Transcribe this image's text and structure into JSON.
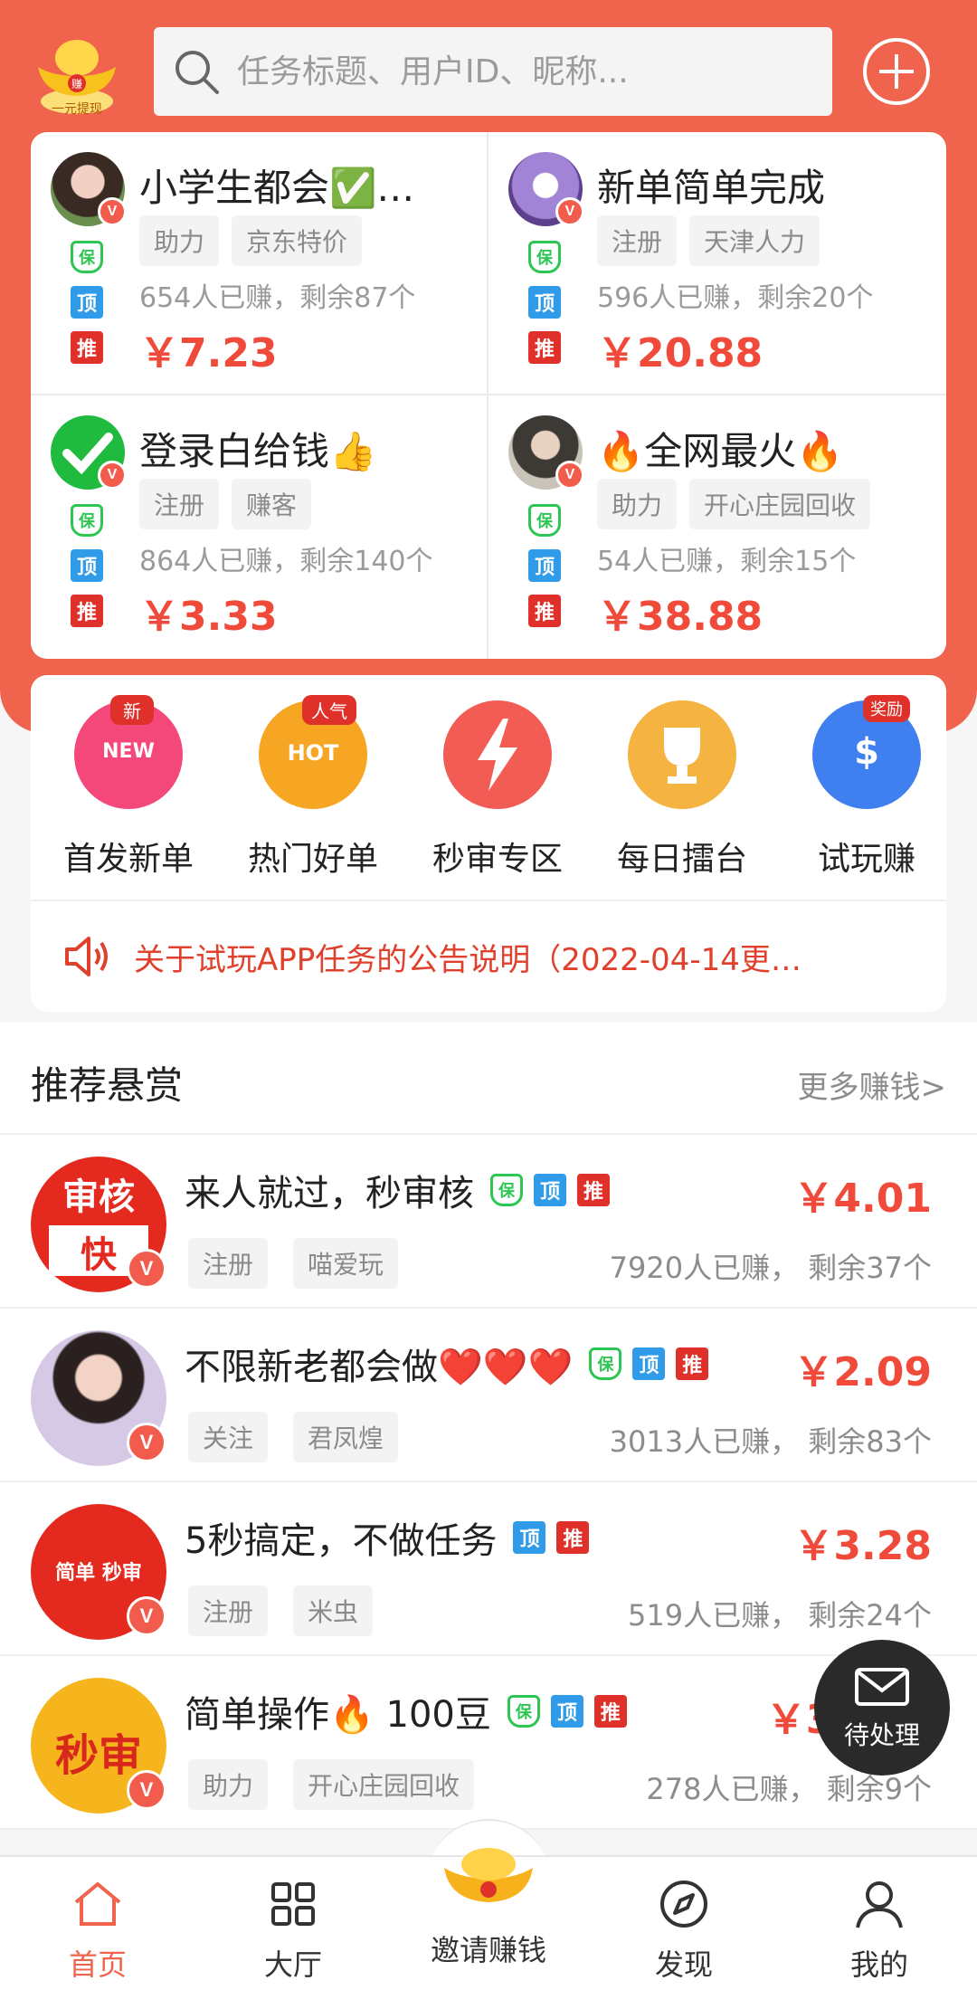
{
  "header": {
    "logo_text": "一元提现",
    "search_placeholder": "任务标题、用户ID、昵称..."
  },
  "featured": [
    {
      "title": "小学生都会✅…",
      "tags": [
        "助力",
        "京东特价"
      ],
      "stat": "654人已赚，剩余87个",
      "price": "￥7.23"
    },
    {
      "title": "新单简单完成",
      "tags": [
        "注册",
        "天津人力"
      ],
      "stat": "596人已赚，剩余20个",
      "price": "￥20.88"
    },
    {
      "title": "登录白给钱👍",
      "tags": [
        "注册",
        "赚客"
      ],
      "stat": "864人已赚，剩余140个",
      "price": "￥3.33"
    },
    {
      "title": "🔥全网最火🔥",
      "tags": [
        "助力",
        "开心庄园回收"
      ],
      "stat": "54人已赚，剩余15个",
      "price": "￥38.88"
    }
  ],
  "badges": {
    "bao": "保",
    "ding": "顶",
    "tui": "推",
    "v": "V"
  },
  "categories": [
    {
      "label": "首发新单",
      "badge": "新",
      "inner": "NEW"
    },
    {
      "label": "热门好单",
      "badge": "人气",
      "inner": "HOT"
    },
    {
      "label": "秒审专区"
    },
    {
      "label": "每日擂台"
    },
    {
      "label": "试玩赚",
      "badge": "奖励"
    }
  ],
  "notice": "关于试玩APP任务的公告说明（2022-04-14更…",
  "recommend": {
    "title": "推荐悬赏",
    "more": "更多赚钱>"
  },
  "list": [
    {
      "title": "来人就过，秒审核",
      "avatar_text": [
        "审核",
        "快"
      ],
      "tags": [
        "注册",
        "喵爱玩"
      ],
      "stat": "7920人已赚， 剩余37个",
      "price": "￥4.01"
    },
    {
      "title": "不限新老都会做❤️❤️❤️",
      "tags": [
        "关注",
        "君凤煌"
      ],
      "stat": "3013人已赚， 剩余83个",
      "price": "￥2.09"
    },
    {
      "title": "5秒搞定，不做任务",
      "avatar_text": [
        "简单 秒审"
      ],
      "tags": [
        "注册",
        "米虫"
      ],
      "stat": "519人已赚， 剩余24个",
      "price": "￥3.28"
    },
    {
      "title": "简单操作🔥 100豆",
      "avatar_text": [
        "秒审"
      ],
      "tags": [
        "助力",
        "开心庄园回收"
      ],
      "stat": "278人已赚， 剩余9个",
      "price": "￥37.00"
    }
  ],
  "pending_label": "待处理",
  "tabs": [
    {
      "label": "首页"
    },
    {
      "label": "大厅"
    },
    {
      "label": "邀请赚钱"
    },
    {
      "label": "发现"
    },
    {
      "label": "我的"
    }
  ],
  "colors": {
    "accent": "#f0644d",
    "price": "#f04a3a",
    "green": "#2dc653",
    "blue": "#2f9be9",
    "red": "#e0302a"
  }
}
